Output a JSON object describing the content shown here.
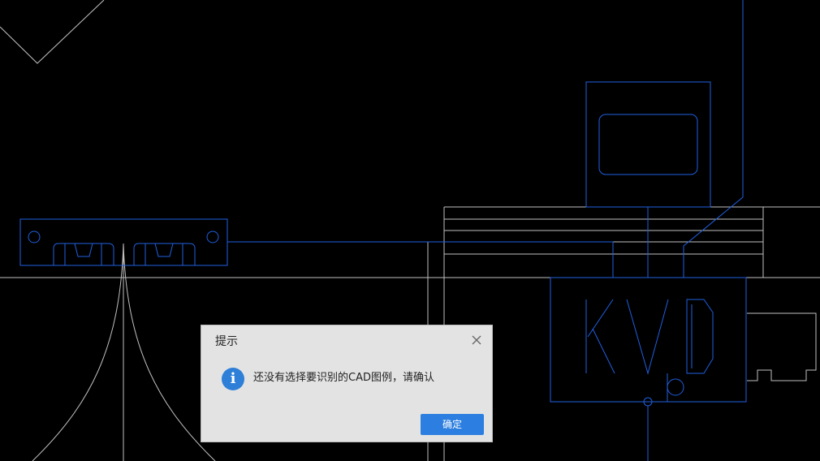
{
  "cad_canvas": {
    "background": "#000000",
    "line_white": "#bfbfbf",
    "line_blue": "#1f5fe0",
    "drawing_text": "KVD"
  },
  "dialog": {
    "title": "提示",
    "close_icon": "close-icon",
    "info_icon": "info-icon",
    "info_glyph": "i",
    "message": "还没有选择要识别的CAD图例，请确认",
    "ok_label": "确定",
    "accent": "#2c7fe0"
  }
}
